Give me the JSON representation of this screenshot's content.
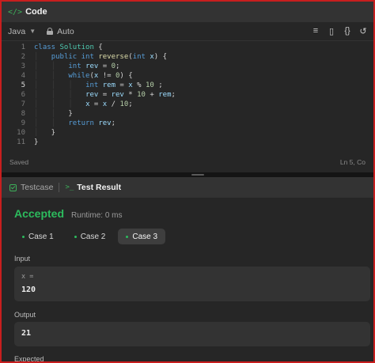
{
  "code_panel": {
    "title": "Code",
    "icon": "code-brackets-icon",
    "language": "Java",
    "mode": "Auto",
    "status_left": "Saved",
    "status_right": "Ln 5, Co",
    "tools": [
      "format-icon",
      "bookmark-icon",
      "braces-icon",
      "reset-icon"
    ]
  },
  "code_lines": [
    {
      "n": "1",
      "text": "class Solution {"
    },
    {
      "n": "2",
      "text": "    public int reverse(int x) {"
    },
    {
      "n": "3",
      "text": "        int rev = 0;"
    },
    {
      "n": "4",
      "text": "        while(x != 0) {"
    },
    {
      "n": "5",
      "text": "            int rem = x % 10 ;"
    },
    {
      "n": "6",
      "text": "            rev = rev * 10 + rem;"
    },
    {
      "n": "7",
      "text": "            x = x / 10;"
    },
    {
      "n": "8",
      "text": "        }"
    },
    {
      "n": "9",
      "text": "        return rev;"
    },
    {
      "n": "10",
      "text": "    }"
    },
    {
      "n": "11",
      "text": "}"
    }
  ],
  "result_panel": {
    "tab_testcase": "Testcase",
    "tab_result": "Test Result",
    "verdict": "Accepted",
    "runtime": "Runtime: 0 ms",
    "cases": [
      "Case 1",
      "Case 2",
      "Case 3"
    ],
    "active_case": "Case 3",
    "input_label": "Input",
    "input_var": "x =",
    "input_value": "120",
    "output_label": "Output",
    "output_value": "21",
    "expected_label": "Expected"
  },
  "colors": {
    "accent_green": "#2cbb5d",
    "frame_red": "#c81e1e",
    "panel_bg": "#262626"
  }
}
